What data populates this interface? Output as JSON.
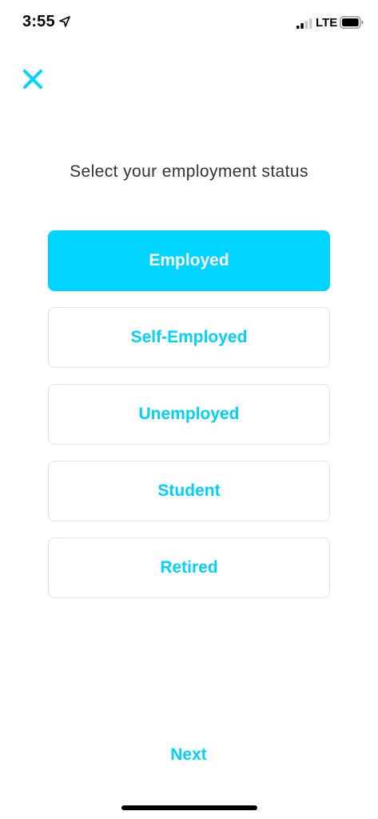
{
  "status_bar": {
    "time": "3:55",
    "network": "LTE",
    "icons": [
      "location-arrow-icon",
      "signal-icon",
      "battery-icon"
    ]
  },
  "header": {
    "close_icon": "close-icon"
  },
  "page": {
    "title": "Select your employment status"
  },
  "options": [
    {
      "label": "Employed",
      "selected": true
    },
    {
      "label": "Self-Employed",
      "selected": false
    },
    {
      "label": "Unemployed",
      "selected": false
    },
    {
      "label": "Student",
      "selected": false
    },
    {
      "label": "Retired",
      "selected": false
    }
  ],
  "footer": {
    "next_label": "Next"
  },
  "colors": {
    "accent": "#00D4FF",
    "text": "#333333",
    "border": "#E3E3E3"
  }
}
